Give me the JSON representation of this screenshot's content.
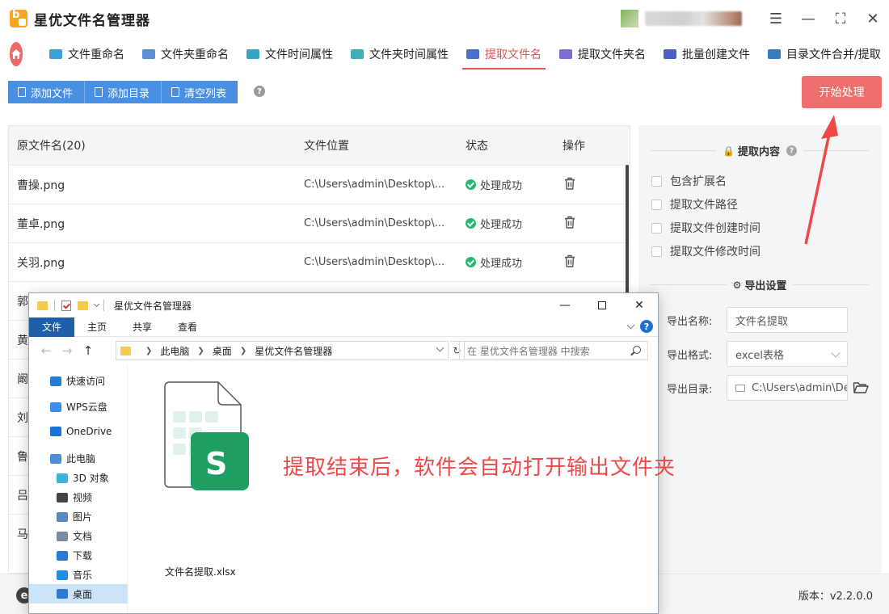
{
  "app": {
    "title": "星优文件名管理器"
  },
  "window_controls": {
    "settings": "☰",
    "minimize": "—",
    "maximize": "⛶",
    "close": "✕"
  },
  "nav": {
    "tabs": [
      {
        "label": "文件重命名",
        "icon": "file-rename-icon",
        "color": "#3aa0d8"
      },
      {
        "label": "文件夹重命名",
        "icon": "folder-rename-icon",
        "color": "#5b8fd6"
      },
      {
        "label": "文件时间属性",
        "icon": "file-time-icon",
        "color": "#36a3c9"
      },
      {
        "label": "文件夹时间属性",
        "icon": "folder-time-icon",
        "color": "#3fb0b8"
      },
      {
        "label": "提取文件名",
        "icon": "extract-filename-icon",
        "color": "#4a6fd0",
        "active": true
      },
      {
        "label": "提取文件夹名",
        "icon": "extract-foldername-icon",
        "color": "#7a6fd0"
      },
      {
        "label": "批量创建文件",
        "icon": "batch-create-icon",
        "color": "#4b5fc4"
      },
      {
        "label": "目录文件合并/提取",
        "icon": "merge-extract-icon",
        "color": "#3a7ac0"
      }
    ]
  },
  "toolbar": {
    "add_file": "添加文件",
    "add_dir": "添加目录",
    "clear_list": "清空列表",
    "help": "?",
    "start": "开始处理"
  },
  "table": {
    "headers": {
      "name": "原文件名(20)",
      "path": "文件位置",
      "status": "状态",
      "op": "操作"
    },
    "rows": [
      {
        "name": "曹操.png",
        "path": "C:\\Users\\admin\\Desktop\\...",
        "status": "处理成功"
      },
      {
        "name": "董卓.png",
        "path": "C:\\Users\\admin\\Desktop\\...",
        "status": "处理成功"
      },
      {
        "name": "关羽.png",
        "path": "C:\\Users\\admin\\Desktop\\...",
        "status": "处理成功"
      },
      {
        "name": "郭"
      },
      {
        "name": "黄"
      },
      {
        "name": "阚"
      },
      {
        "name": "刘"
      },
      {
        "name": "鲁"
      },
      {
        "name": "吕"
      },
      {
        "name": "马"
      }
    ]
  },
  "panel": {
    "extract_title": "提取内容",
    "help": "?",
    "options": [
      "包含扩展名",
      "提取文件路径",
      "提取文件创建时间",
      "提取文件修改时间"
    ],
    "export_title": "导出设置",
    "export_name_label": "导出名称:",
    "export_name_value": "文件名提取",
    "export_format_label": "导出格式:",
    "export_format_value": "excel表格",
    "export_dir_label": "导出目录:",
    "export_dir_value": "C:\\Users\\admin\\Des"
  },
  "footer": {
    "logo": "e",
    "version": "版本：v2.2.0.0"
  },
  "annotation": {
    "text": "提取结束后，软件会自动打开输出文件夹",
    "color": "#f04848"
  },
  "explorer": {
    "title": "星优文件名管理器",
    "ribbon": {
      "file": "文件",
      "home": "主页",
      "share": "共享",
      "view": "查看",
      "help": "?"
    },
    "nav_back": "←",
    "nav_forward": "→",
    "nav_up": "↑",
    "breadcrumb": [
      "此电脑",
      "桌面",
      "星优文件名管理器"
    ],
    "refresh": "↻",
    "search_placeholder": "在 星优文件名管理器 中搜索",
    "sidebar": [
      {
        "label": "快速访问",
        "icon": "star-icon",
        "color": "#2a7bd4"
      },
      {
        "label": "WPS云盘",
        "icon": "cloud-icon",
        "color": "#3d8ef0"
      },
      {
        "label": "OneDrive",
        "icon": "onedrive-icon",
        "color": "#1a73d9"
      },
      {
        "label": "此电脑",
        "icon": "computer-icon",
        "color": "#4a90d6"
      },
      {
        "label": "3D 对象",
        "icon": "cube-icon",
        "color": "#3cb6d8"
      },
      {
        "label": "视频",
        "icon": "video-icon",
        "color": "#444"
      },
      {
        "label": "图片",
        "icon": "picture-icon",
        "color": "#5a8ac0"
      },
      {
        "label": "文档",
        "icon": "document-icon",
        "color": "#7a8ca0"
      },
      {
        "label": "下载",
        "icon": "download-icon",
        "color": "#2a7bd4"
      },
      {
        "label": "音乐",
        "icon": "music-icon",
        "color": "#1e90e0"
      },
      {
        "label": "桌面",
        "icon": "desktop-icon",
        "color": "#2a7bd4"
      }
    ],
    "file": {
      "name": "文件名提取.xlsx",
      "badge": "S",
      "badge_color": "#1e9e62"
    }
  }
}
